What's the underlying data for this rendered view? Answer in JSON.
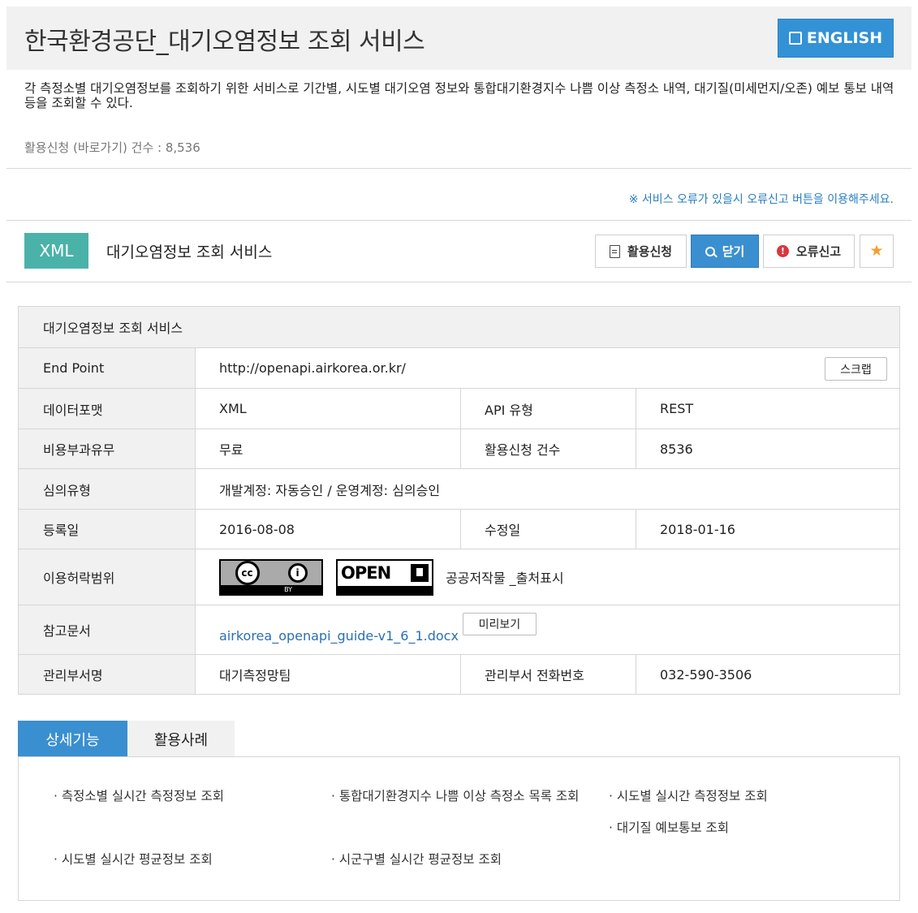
{
  "header": {
    "title": "한국환경공단_대기오염정보 조회 서비스",
    "english_button": "ENGLISH"
  },
  "description": "각 측정소별 대기오염정보를 조회하기 위한 서비스로 기간별, 시도별 대기오염 정보와 통합대기환경지수 나쁨 이상 측정소 내역, 대기질(미세먼지/오존) 예보 통보 내역 등을 조회할 수 있다.",
  "apply_count": "활용신청 (바로가기) 건수 : 8,536",
  "notice": "※ 서비스 오류가 있을시 오류신고 버튼을 이용해주세요.",
  "service": {
    "type_badge": "XML",
    "name": "대기오염정보 조회 서비스",
    "buttons": {
      "apply": "활용신청",
      "close": "닫기",
      "report": "오류신고"
    }
  },
  "info": {
    "header": "대기오염정보 조회 서비스",
    "endpoint_label": "End Point",
    "endpoint_value": "http://openapi.airkorea.or.kr/",
    "scrap_button": "스크랩",
    "data_format_label": "데이터포맷",
    "data_format_value": "XML",
    "api_type_label": "API 유형",
    "api_type_value": "REST",
    "fee_label": "비용부과유무",
    "fee_value": "무료",
    "apply_count_label": "활용신청 건수",
    "apply_count_value": "8536",
    "review_label": "심의유형",
    "review_value": "개발계정: 자동승인 / 운영계정: 심의승인",
    "reg_date_label": "등록일",
    "reg_date_value": "2016-08-08",
    "mod_date_label": "수정일",
    "mod_date_value": "2018-01-16",
    "license_label": "이용허락범위",
    "license_cc": "cc",
    "license_by": "BY",
    "license_open": "OPEN",
    "license_text": "공공저작물 _출처표시",
    "ref_label": "참고문서",
    "ref_link": "airkorea_openapi_guide-v1_6_1.docx",
    "preview_button": "미리보기",
    "dept_label": "관리부서명",
    "dept_value": "대기측정망팀",
    "phone_label": "관리부서 전화번호",
    "phone_value": "032-590-3506"
  },
  "tabs": {
    "detail": "상세기능",
    "cases": "활용사례"
  },
  "functions": [
    "· 측정소별 실시간 측정정보 조회",
    "· 통합대기환경지수 나쁨 이상 측정소 목록 조회",
    "· 시도별 실시간 측정정보 조회",
    "· 대기질 예보통보 조회",
    "· 시도별 실시간 평균정보 조회",
    "· 시군구별 실시간 평균정보 조회"
  ],
  "colors": {
    "primary_blue": "#3a8fd0",
    "xml_badge": "#4bb2a9",
    "link": "#2a6fb1",
    "warn": "#d9363e",
    "star": "#f0a030"
  }
}
